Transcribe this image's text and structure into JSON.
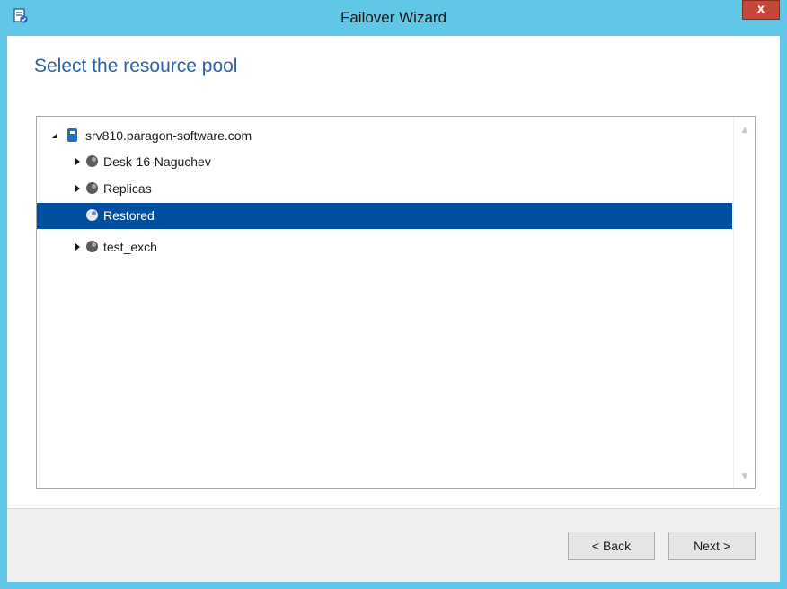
{
  "window": {
    "title": "Failover Wizard",
    "close_label": "x"
  },
  "page": {
    "heading": "Select the resource pool"
  },
  "tree": {
    "items": [
      {
        "label": "srv810.paragon-software.com",
        "type": "server",
        "expanded": true,
        "level": 0
      },
      {
        "label": "Desk-16-Naguchev",
        "type": "resource-pool",
        "expanded": false,
        "level": 1
      },
      {
        "label": "Replicas",
        "type": "resource-pool",
        "expanded": false,
        "level": 1
      },
      {
        "label": "Restored",
        "type": "resource-pool",
        "selected": true,
        "level": 1
      },
      {
        "label": "test_exch",
        "type": "resource-pool",
        "expanded": false,
        "level": 1
      }
    ]
  },
  "buttons": {
    "back_label": "< Back",
    "next_label": "Next >"
  },
  "colors": {
    "titlebar": "#60c8e6",
    "heading": "#2c62a3",
    "selection": "#004fa0",
    "close_button": "#c7463a"
  },
  "icons": {
    "app": "wizard-app-icon",
    "server": "server-icon",
    "pool": "resource-pool-icon",
    "scroll_up": "scroll-up-icon",
    "scroll_down": "scroll-down-icon"
  }
}
